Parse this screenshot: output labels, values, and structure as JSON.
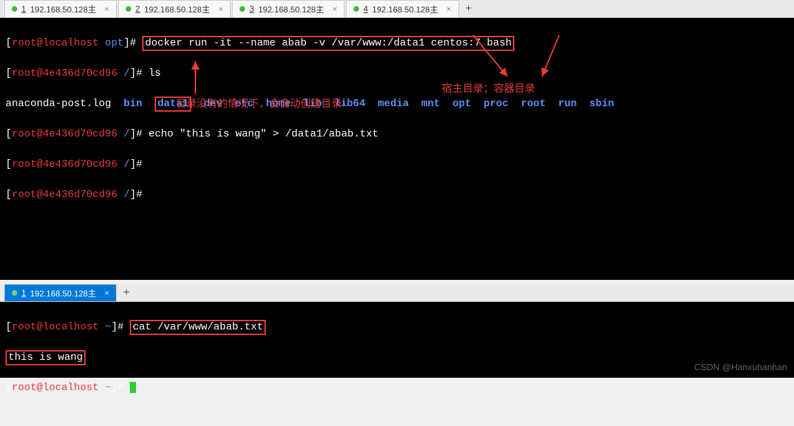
{
  "tabBar1": {
    "tabs": [
      {
        "num": "1",
        "label": "192.168.50.128主"
      },
      {
        "num": "2",
        "label": "192.168.50.128主"
      },
      {
        "num": "3",
        "label": "192.168.50.128主"
      },
      {
        "num": "4",
        "label": "192.168.50.128主"
      }
    ]
  },
  "term1": {
    "line1": {
      "userhost": "root@localhost",
      "path": "opt",
      "cmd": "docker run -it --name abab -v /var/www:/data1 centos:7 bash"
    },
    "line2": {
      "userhost": "root@4e436d70cd96",
      "path": "/",
      "cmd": "ls"
    },
    "ls": {
      "items": [
        {
          "text": "anaconda-post.log",
          "color": "white"
        },
        {
          "text": "bin",
          "color": "blue"
        },
        {
          "text": "data1",
          "color": "blue",
          "boxed": true
        },
        {
          "text": "dev",
          "color": "blue"
        },
        {
          "text": "etc",
          "color": "blue"
        },
        {
          "text": "home",
          "color": "blue"
        },
        {
          "text": "lib",
          "color": "blue"
        },
        {
          "text": "lib64",
          "color": "blue"
        },
        {
          "text": "media",
          "color": "blue"
        },
        {
          "text": "mnt",
          "color": "blue"
        },
        {
          "text": "opt",
          "color": "blue"
        },
        {
          "text": "proc",
          "color": "blue"
        },
        {
          "text": "root",
          "color": "blue"
        },
        {
          "text": "run",
          "color": "blue"
        },
        {
          "text": "sbin",
          "color": "blue"
        }
      ]
    },
    "line4": {
      "userhost": "root@4e436d70cd96",
      "path": "/",
      "cmd": "echo \"this is wang\" > /data1/abab.txt"
    },
    "line5": {
      "userhost": "root@4e436d70cd96",
      "path": "/"
    },
    "line6": {
      "userhost": "root@4e436d70cd96",
      "path": "/"
    },
    "annot1": "宿主目录；容器目录",
    "annot2": "目录没有的情况下，会自动创建目录"
  },
  "tabBar2": {
    "tabs": [
      {
        "num": "1",
        "label": "192.168.50.128主",
        "active": true
      }
    ]
  },
  "term2": {
    "line1": {
      "userhost": "root@localhost",
      "path": "~",
      "cmd": "cat /var/www/abab.txt"
    },
    "output": "this is wang",
    "line3": {
      "userhost": "root@localhost",
      "path": "~"
    }
  },
  "watermark": "CSDN @Hanxuhanhan",
  "glyphs": {
    "close": "×",
    "plus": "+",
    "bullet": "•"
  }
}
